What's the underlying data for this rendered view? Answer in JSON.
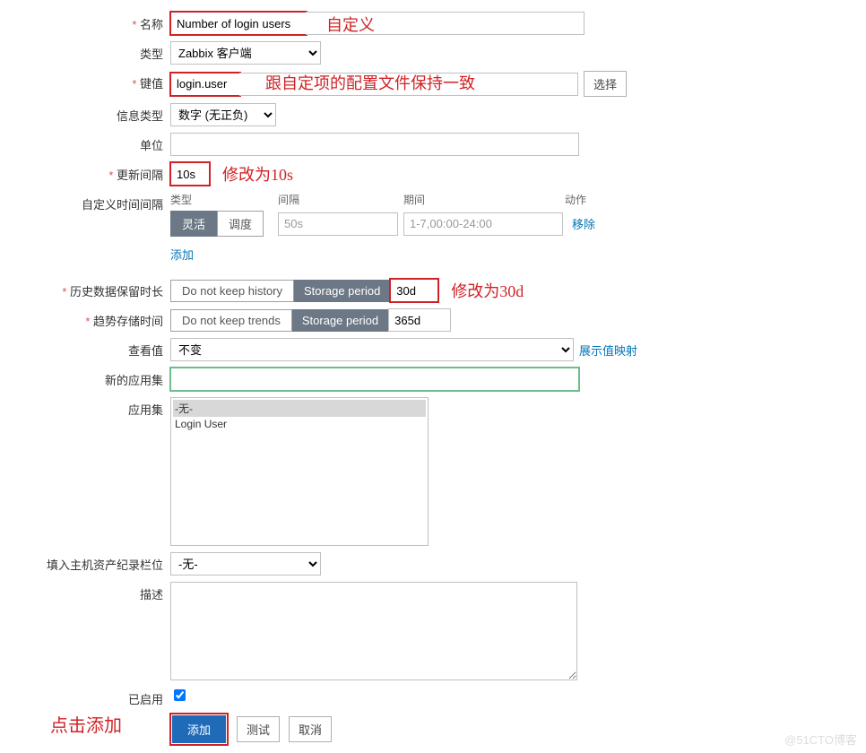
{
  "labels": {
    "name": "名称",
    "type": "类型",
    "key": "键值",
    "infoType": "信息类型",
    "unit": "单位",
    "updateInterval": "更新间隔",
    "customInterval": "自定义时间间隔",
    "historyKeep": "历史数据保留时长",
    "trendKeep": "趋势存储时间",
    "viewValue": "查看值",
    "newAppSet": "新的应用集",
    "appSet": "应用集",
    "populateHost": "填入主机资产纪录栏位",
    "description": "描述",
    "enabled": "已启用"
  },
  "fields": {
    "name": "Number of login users",
    "typeSelect": "Zabbix 客户端",
    "key": "login.user",
    "selectBtn": "选择",
    "infoTypeSelect": "数字 (无正负)",
    "unit": "",
    "updateInterval": "10s",
    "historyNoKeep": "Do not keep history",
    "historyStorage": "Storage period",
    "historyValue": "30d",
    "trendNoKeep": "Do not keep trends",
    "trendStorage": "Storage period",
    "trendValue": "365d",
    "viewValueSelect": "不变",
    "viewValueLink": "展示值映射",
    "newAppSet": "",
    "populateHostSelect": "-无-",
    "description": ""
  },
  "appSet": {
    "items": [
      "-无-",
      "Login User"
    ]
  },
  "customInterval": {
    "headers": {
      "type": "类型",
      "interval": "间隔",
      "period": "期间",
      "action": "动作"
    },
    "segFlexible": "灵活",
    "segSchedule": "调度",
    "interval": "50s",
    "period": "1-7,00:00-24:00",
    "remove": "移除",
    "add": "添加"
  },
  "annotations": {
    "name": "自定义",
    "key": "跟自定项的配置文件保持一致",
    "updateInterval": "修改为10s",
    "history": "修改为30d",
    "bottom": "点击添加"
  },
  "buttons": {
    "add": "添加",
    "test": "测试",
    "cancel": "取消"
  },
  "watermark": "@51CTO博客"
}
